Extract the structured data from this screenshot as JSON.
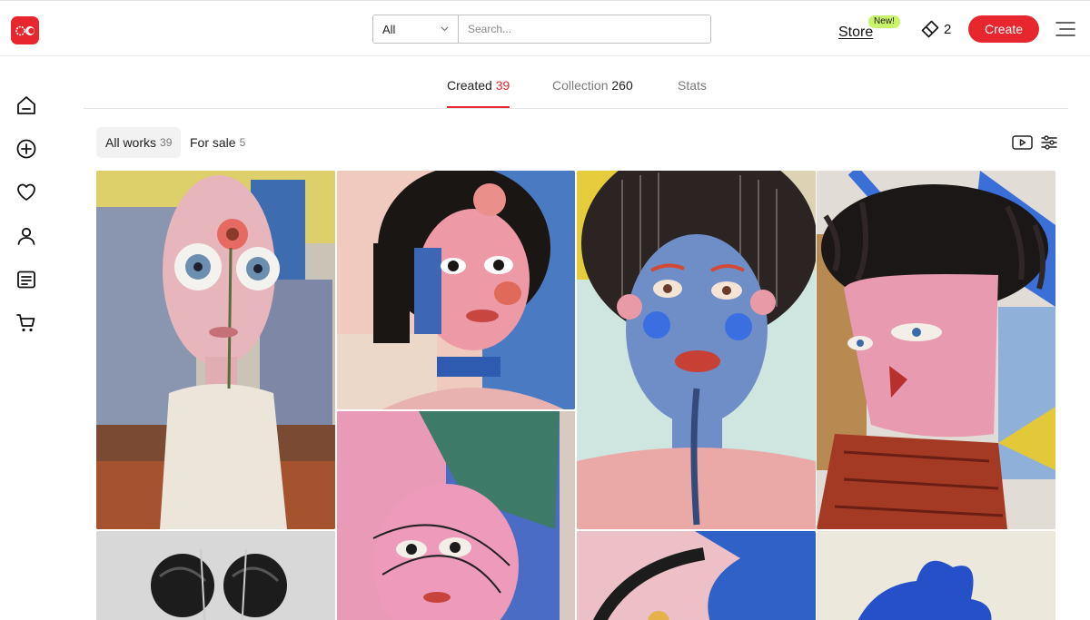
{
  "header": {
    "search_category": "All",
    "search_placeholder": "Search...",
    "store_label": "Store",
    "new_badge": "New!",
    "credits_count": "2",
    "create_label": "Create"
  },
  "tabs": [
    {
      "label": "Created",
      "count": "39",
      "active": true
    },
    {
      "label": "Collection",
      "count": "260",
      "active": false
    },
    {
      "label": "Stats",
      "count": "",
      "active": false
    }
  ],
  "filters": [
    {
      "label": "All works",
      "count": "39",
      "active": true
    },
    {
      "label": "For sale",
      "count": "5",
      "active": false
    }
  ],
  "sidebar": [
    {
      "icon": "home-icon"
    },
    {
      "icon": "plus-circle-icon"
    },
    {
      "icon": "heart-icon"
    },
    {
      "icon": "user-icon"
    },
    {
      "icon": "document-icon"
    },
    {
      "icon": "cart-icon"
    }
  ],
  "toolbar": [
    {
      "icon": "video-play-icon"
    },
    {
      "icon": "sliders-icon"
    }
  ],
  "colors": {
    "accent": "#e8262d",
    "badge": "#c9f36a"
  }
}
